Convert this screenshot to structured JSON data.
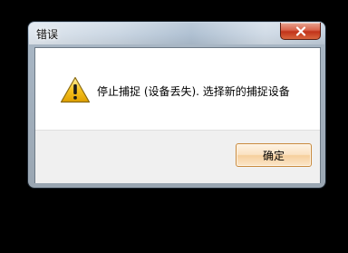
{
  "window": {
    "title": "错误"
  },
  "dialog": {
    "icon": "warning-icon",
    "message": "停止捕捉 (设备丢失). 选择新的捕捉设备"
  },
  "buttons": {
    "ok_label": "确定",
    "close_icon": "close-icon"
  },
  "colors": {
    "close_button": "#c1331a",
    "ok_button_border": "#c98a3e",
    "warning_yellow": "#f6c321"
  }
}
